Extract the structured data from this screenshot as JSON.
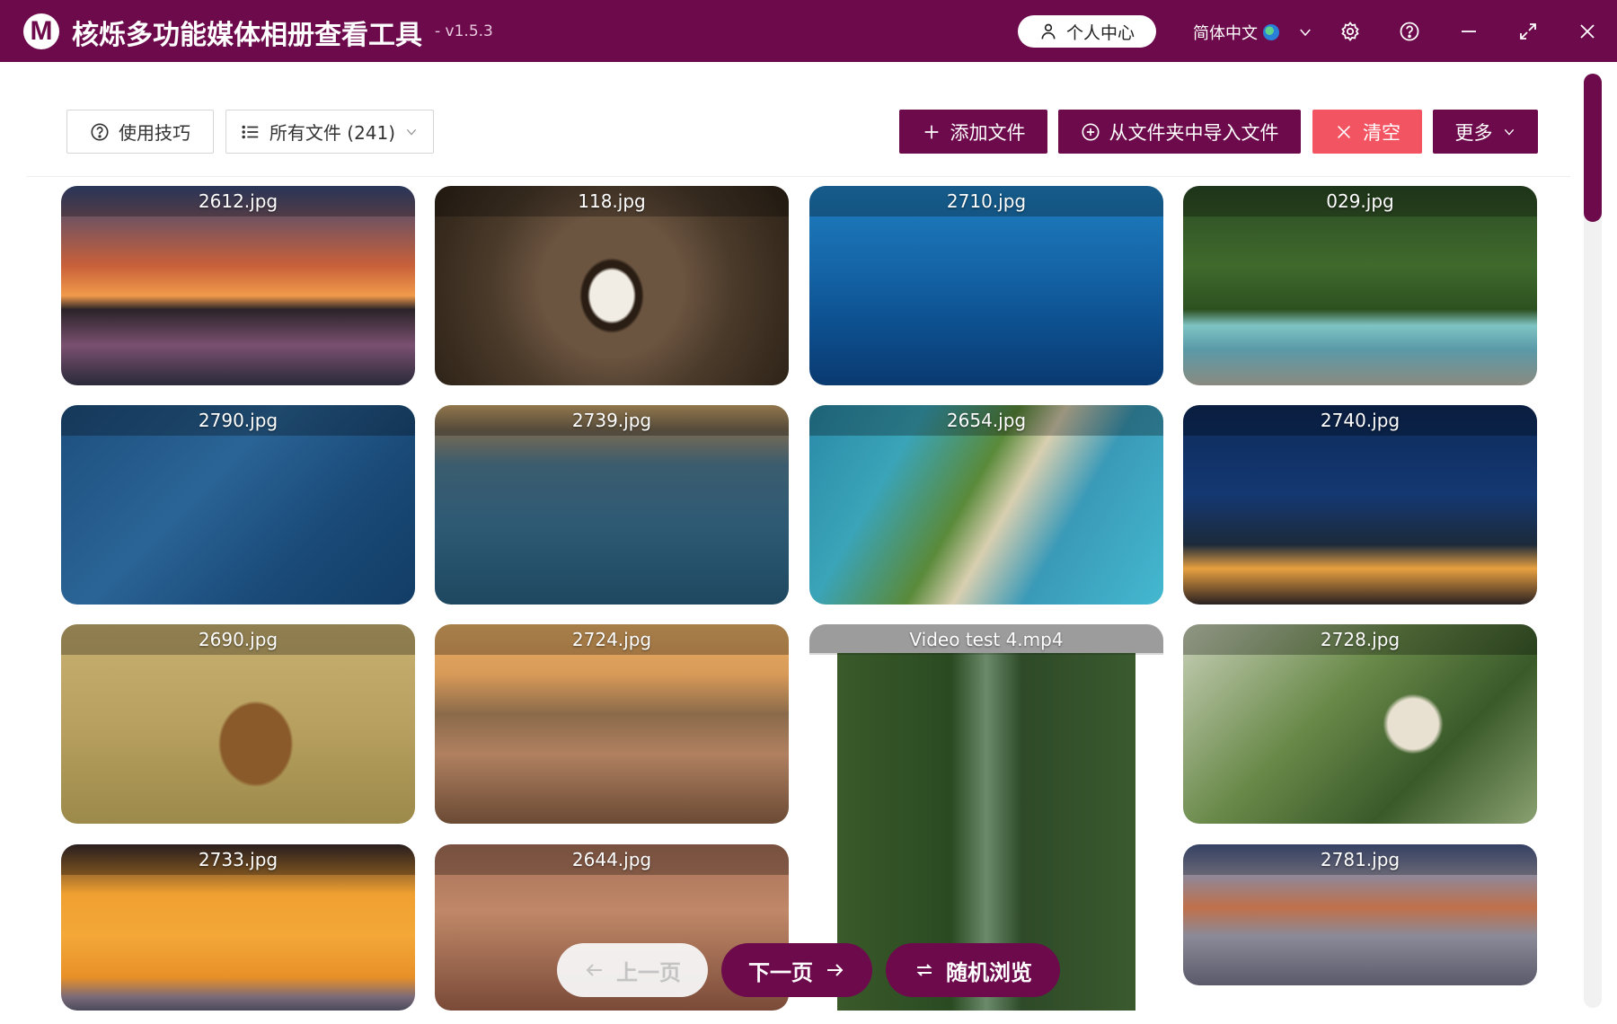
{
  "app": {
    "logo_letter": "M",
    "title": "核烁多功能媒体相册查看工具",
    "version": "- v1.5.3"
  },
  "titlebar": {
    "user_center_label": "个人中心",
    "language_label": "简体中文",
    "icons": [
      "user-icon",
      "globe-icon",
      "chevron-down-icon",
      "gear-icon",
      "help-icon",
      "minimize-icon",
      "maximize-icon",
      "close-icon"
    ]
  },
  "toolbar": {
    "tips_label": "使用技巧",
    "filter_label": "所有文件 (241)",
    "add_label": "添加文件",
    "import_label": "从文件夹中导入文件",
    "clear_label": "清空",
    "more_label": "更多"
  },
  "gallery": {
    "items": [
      {
        "name": "2612.jpg",
        "type": "image"
      },
      {
        "name": "118.jpg",
        "type": "image"
      },
      {
        "name": "2710.jpg",
        "type": "image"
      },
      {
        "name": "029.jpg",
        "type": "image"
      },
      {
        "name": "2790.jpg",
        "type": "image"
      },
      {
        "name": "2739.jpg",
        "type": "image"
      },
      {
        "name": "2654.jpg",
        "type": "image"
      },
      {
        "name": "2740.jpg",
        "type": "image"
      },
      {
        "name": "2690.jpg",
        "type": "image"
      },
      {
        "name": "2724.jpg",
        "type": "image"
      },
      {
        "name": "Video test 4.mp4",
        "type": "video"
      },
      {
        "name": "2728.jpg",
        "type": "image"
      },
      {
        "name": "2733.jpg",
        "type": "image"
      },
      {
        "name": "2644.jpg",
        "type": "image"
      },
      {
        "name": "2781.jpg",
        "type": "image"
      }
    ]
  },
  "pagination": {
    "prev_label": "上一页",
    "next_label": "下一页",
    "random_label": "随机浏览"
  },
  "colors": {
    "brand": "#6d0a4c",
    "danger": "#f25462"
  }
}
